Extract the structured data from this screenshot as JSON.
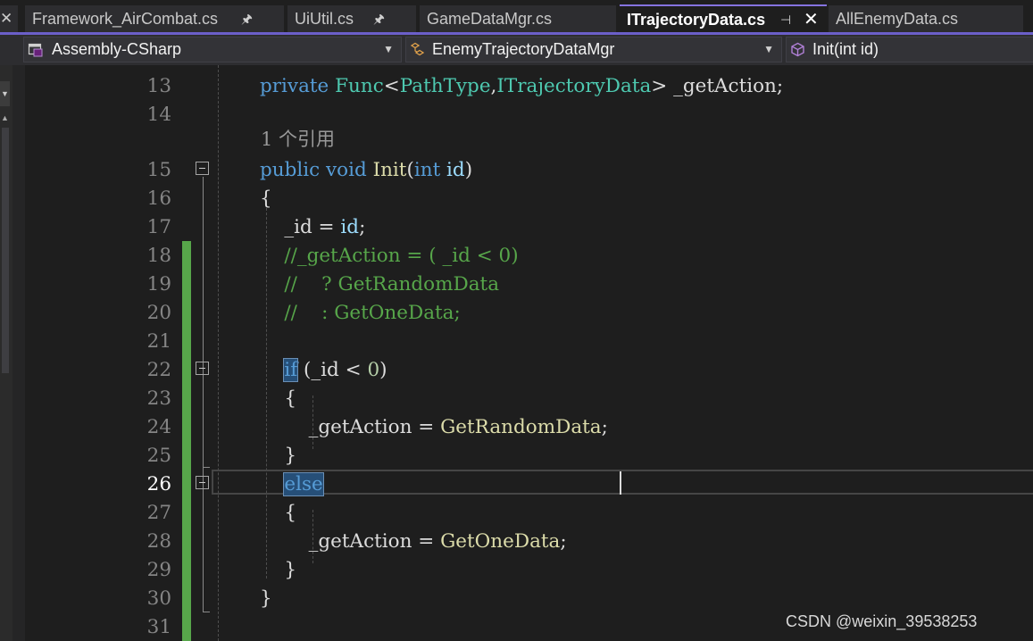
{
  "tabs": [
    {
      "label": "Framework_AirCombat.cs",
      "pinned": true
    },
    {
      "label": "UiUtil.cs",
      "pinned": true
    },
    {
      "label": "GameDataMgr.cs",
      "pinned": false
    },
    {
      "label": "ITrajectoryData.cs",
      "pinned": true,
      "active": true
    },
    {
      "label": "AllEnemyData.cs",
      "pinned": false
    }
  ],
  "navbar": {
    "project": "Assembly-CSharp",
    "class": "EnemyTrajectoryDataMgr",
    "member": "Init(int id)"
  },
  "editor": {
    "codelens": "1 个引用",
    "current_line": "26",
    "lines": [
      {
        "num": "13",
        "segments": [
          [
            "kw",
            "private "
          ],
          [
            "ty",
            "Func"
          ],
          [
            "p",
            "<"
          ],
          [
            "ty",
            "PathType"
          ],
          [
            "p",
            ","
          ],
          [
            "ty",
            "ITrajectoryData"
          ],
          [
            "p",
            "> _getAction;"
          ]
        ]
      },
      {
        "num": "14",
        "segments": []
      },
      {
        "num": "15",
        "segments": [
          [
            "kw",
            "public "
          ],
          [
            "kw",
            "void "
          ],
          [
            "fn",
            "Init"
          ],
          [
            "p",
            "("
          ],
          [
            "kw",
            "int "
          ],
          [
            "pr",
            "id"
          ],
          [
            "p",
            ")"
          ]
        ]
      },
      {
        "num": "16",
        "segments": [
          [
            "p",
            "{"
          ]
        ]
      },
      {
        "num": "17",
        "segments": [
          [
            "p",
            "    _id = "
          ],
          [
            "pr",
            "id"
          ],
          [
            "p",
            ";"
          ]
        ]
      },
      {
        "num": "18",
        "segments": [
          [
            "cm",
            "    //_getAction = ( _id < 0)"
          ]
        ]
      },
      {
        "num": "19",
        "segments": [
          [
            "cm",
            "    //    ? GetRandomData"
          ]
        ]
      },
      {
        "num": "20",
        "segments": [
          [
            "cm",
            "    //    : GetOneData;"
          ]
        ]
      },
      {
        "num": "21",
        "segments": []
      },
      {
        "num": "22",
        "segments": [
          [
            "p",
            "    "
          ],
          [
            "kwhl",
            "if"
          ],
          [
            "p",
            " (_id < "
          ],
          [
            "nm",
            "0"
          ],
          [
            "p",
            ")"
          ]
        ]
      },
      {
        "num": "23",
        "segments": [
          [
            "p",
            "    {"
          ]
        ]
      },
      {
        "num": "24",
        "segments": [
          [
            "p",
            "        _getAction = "
          ],
          [
            "fn",
            "GetRandomData"
          ],
          [
            "p",
            ";"
          ]
        ]
      },
      {
        "num": "25",
        "segments": [
          [
            "p",
            "    }"
          ]
        ]
      },
      {
        "num": "26",
        "segments": [
          [
            "p",
            "    "
          ],
          [
            "kwhl",
            "else"
          ]
        ]
      },
      {
        "num": "27",
        "segments": [
          [
            "p",
            "    {"
          ]
        ]
      },
      {
        "num": "28",
        "segments": [
          [
            "p",
            "        _getAction = "
          ],
          [
            "fn",
            "GetOneData"
          ],
          [
            "p",
            ";"
          ]
        ]
      },
      {
        "num": "29",
        "segments": [
          [
            "p",
            "    }"
          ]
        ]
      },
      {
        "num": "30",
        "segments": [
          [
            "p",
            "}"
          ]
        ]
      },
      {
        "num": "31",
        "segments": []
      }
    ]
  },
  "watermark": "CSDN @weixin_39538253",
  "colors": {
    "keyword": "#569cd6",
    "type": "#4ec9b0",
    "method": "#dcdcaa",
    "parameter": "#9cdcfe",
    "number": "#b5cea8",
    "comment": "#57a64a",
    "change_bar": "#57a64a",
    "active_tab_accent": "#8573e0"
  }
}
